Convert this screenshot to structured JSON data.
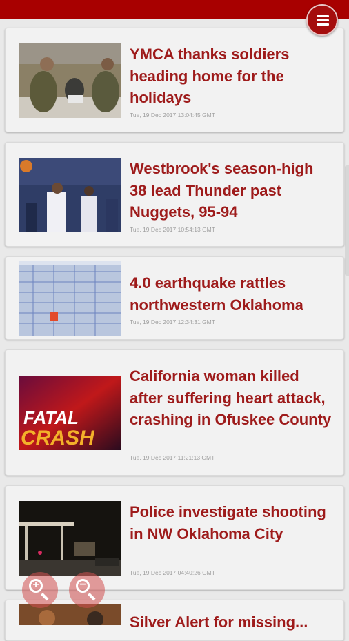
{
  "menu": {
    "icon": "hamburger-menu-icon"
  },
  "articles": [
    {
      "title": "YMCA thanks soldiers heading home for the holidays",
      "time": "Tue, 19 Dec 2017 13:04:45 GMT"
    },
    {
      "title": "Westbrook's season-high 38 lead Thunder past Nuggets, 95-94",
      "time": "Tue, 19 Dec 2017 10:54:13 GMT"
    },
    {
      "title": "4.0 earthquake rattles northwestern Oklahoma",
      "time": "Tue, 19 Dec 2017 12:34:31 GMT"
    },
    {
      "title": "California woman killed after suffering heart attack, crashing in Ofuskee County",
      "time": "Tue, 19 Dec 2017 11:21:13 GMT",
      "thumb_text_1": "FATAL",
      "thumb_text_2": "CRASH"
    },
    {
      "title": "Police investigate shooting in NW Oklahoma City",
      "time": "Tue, 19 Dec 2017 04:40:26 GMT"
    },
    {
      "title": "Silver Alert for missing..."
    }
  ],
  "zoom": {
    "in_icon": "zoom-in-icon",
    "out_icon": "zoom-out-icon"
  },
  "colors": {
    "brand": "#a80000",
    "headline": "#9e1b1b"
  }
}
